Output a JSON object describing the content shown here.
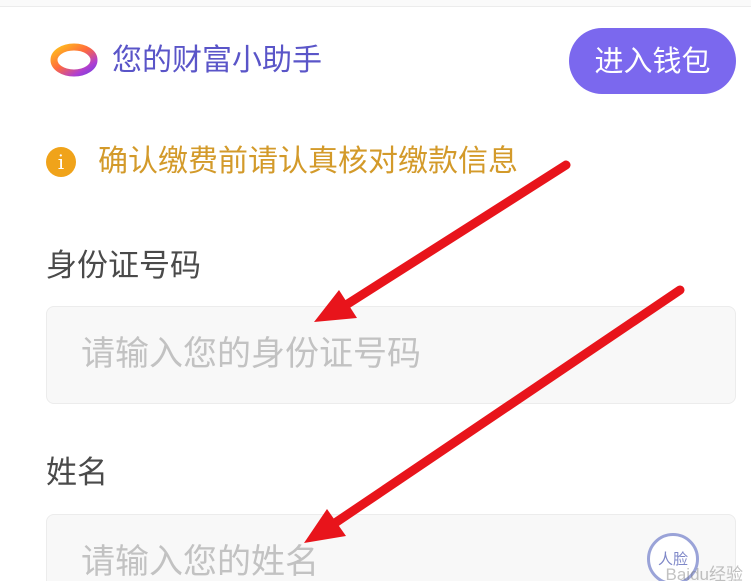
{
  "wealth_bar": {
    "title": "您的财富小助手",
    "enter_wallet_label": "进入钱包"
  },
  "notice": {
    "icon_glyph": "i",
    "text": "确认缴费前请认真核对缴款信息",
    "color": "#d39a2a"
  },
  "form": {
    "id_number": {
      "label": "身份证号码",
      "placeholder": "请输入您的身份证号码",
      "value": ""
    },
    "name": {
      "label": "姓名",
      "placeholder": "请输入您的姓名",
      "value": "",
      "scan_icon_text": "人脸"
    }
  },
  "watermark": "Baidu经验",
  "colors": {
    "accent": "#7b68ee",
    "title": "#5a55c8",
    "warning": "#f0a31a",
    "annotation_arrow": "#e8141b"
  }
}
